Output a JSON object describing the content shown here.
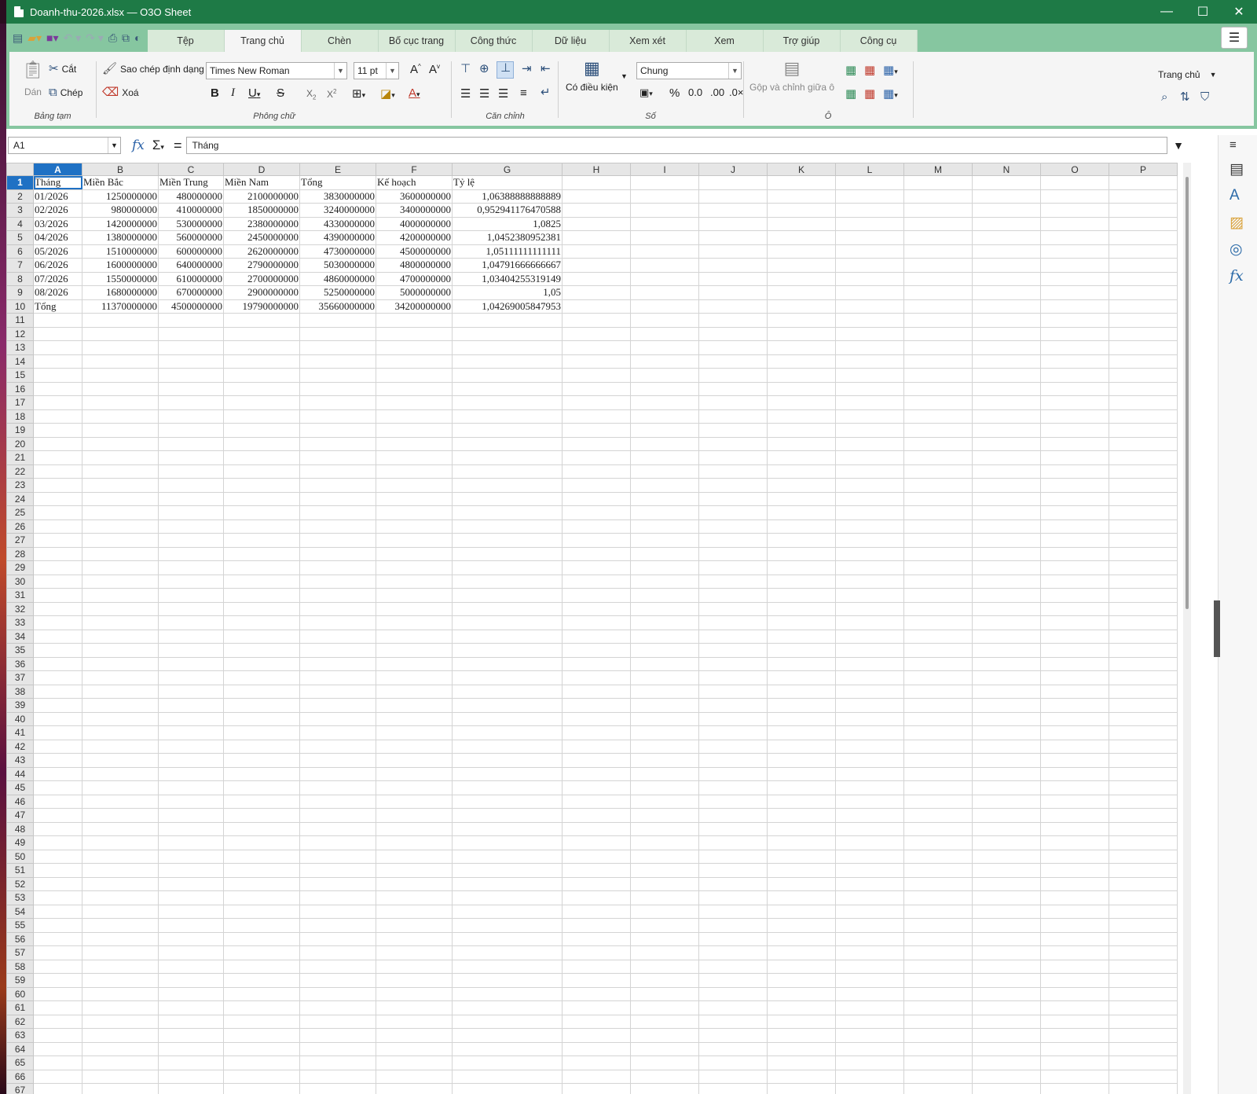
{
  "window": {
    "title": "Doanh-thu-2026.xlsx — O3O Sheet",
    "controls": {
      "minimize": "—",
      "maximize": "☐",
      "close": "✕"
    }
  },
  "tabs": [
    "Tệp",
    "Trang chủ",
    "Chèn",
    "Bố cục trang",
    "Công thức",
    "Dữ liệu",
    "Xem xét",
    "Xem",
    "Trợ giúp",
    "Công cụ"
  ],
  "active_tab": "Trang chủ",
  "ribbon": {
    "clipboard": {
      "paste": "Dán",
      "cut": "Cắt",
      "copy": "Chép",
      "label": "Bảng tạm"
    },
    "font": {
      "format_painter": "Sao chép định dạng",
      "clear": "Xoá",
      "font_name": "Times New Roman",
      "font_size": "11 pt",
      "label": "Phông chữ"
    },
    "alignment": {
      "label": "Căn chỉnh"
    },
    "number": {
      "conditional": "Có điều kiện",
      "format": "Chung",
      "label": "Số"
    },
    "cells": {
      "merge": "Gộp và chỉnh giữa ô",
      "label": "Ô"
    },
    "home_dropdown": "Trang chủ"
  },
  "formula_bar": {
    "cell_ref": "A1",
    "content": "Tháng"
  },
  "sheet": {
    "columns": [
      "A",
      "B",
      "C",
      "D",
      "E",
      "F",
      "G",
      "H",
      "I",
      "J",
      "K",
      "L",
      "M",
      "N",
      "O",
      "P"
    ],
    "rows": [
      [
        "Tháng",
        "Miền Bắc",
        "Miền Trung",
        "Miền Nam",
        "Tổng",
        "Kế hoạch",
        "Tỷ lệ"
      ],
      [
        "01/2026",
        "1250000000",
        "480000000",
        "2100000000",
        "3830000000",
        "3600000000",
        "1,06388888888889"
      ],
      [
        "02/2026",
        "980000000",
        "410000000",
        "1850000000",
        "3240000000",
        "3400000000",
        "0,952941176470588"
      ],
      [
        "03/2026",
        "1420000000",
        "530000000",
        "2380000000",
        "4330000000",
        "4000000000",
        "1,0825"
      ],
      [
        "04/2026",
        "1380000000",
        "560000000",
        "2450000000",
        "4390000000",
        "4200000000",
        "1,0452380952381"
      ],
      [
        "05/2026",
        "1510000000",
        "600000000",
        "2620000000",
        "4730000000",
        "4500000000",
        "1,05111111111111"
      ],
      [
        "06/2026",
        "1600000000",
        "640000000",
        "2790000000",
        "5030000000",
        "4800000000",
        "1,04791666666667"
      ],
      [
        "07/2026",
        "1550000000",
        "610000000",
        "2700000000",
        "4860000000",
        "4700000000",
        "1,03404255319149"
      ],
      [
        "08/2026",
        "1680000000",
        "670000000",
        "2900000000",
        "5250000000",
        "5000000000",
        "1,05"
      ],
      [
        "Tổng",
        "11370000000",
        "4500000000",
        "19790000000",
        "35660000000",
        "34200000000",
        "1,04269005847953"
      ]
    ],
    "total_rows": 68
  }
}
